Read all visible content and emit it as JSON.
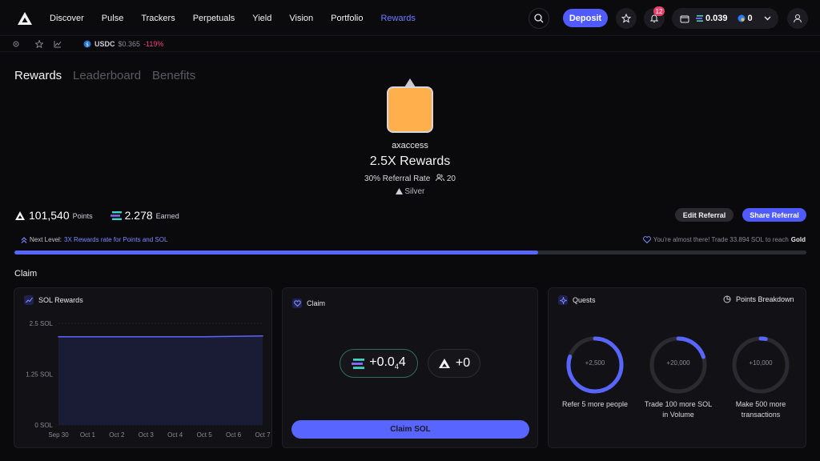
{
  "nav": {
    "links": [
      "Discover",
      "Pulse",
      "Trackers",
      "Perpetuals",
      "Yield",
      "Vision",
      "Portfolio",
      "Rewards"
    ],
    "active": "Rewards",
    "deposit_label": "Deposit",
    "notifications": "12",
    "wallet_sol": "0.039",
    "wallet_other": "0"
  },
  "subbar": {
    "ticker_symbol": "USDC",
    "ticker_price": "$0.365",
    "ticker_change": "-119%"
  },
  "tabs": [
    "Rewards",
    "Leaderboard",
    "Benefits"
  ],
  "profile": {
    "username": "axaccess",
    "multiplier": "2.5X Rewards",
    "referral_rate": "30% Referral Rate",
    "referral_count": "20",
    "tier": "Silver"
  },
  "points": {
    "points_value": "101,540",
    "points_label": "Points",
    "earned_value": "2.278",
    "earned_label": "Earned",
    "edit_referral": "Edit Referral",
    "share_referral": "Share Referral"
  },
  "progress": {
    "next_level_label": "Next Level:",
    "next_level_text": "3X Rewards rate for Points and SOL",
    "almost_text": "You're almost there! Trade 33.894 SOL to reach",
    "target_tier": "Gold",
    "fraction": 0.661
  },
  "claim_heading": "Claim",
  "sol_rewards": {
    "title": "SOL Rewards"
  },
  "claim_panel": {
    "title": "Claim",
    "sol_amount_main": "+0.0",
    "sol_amount_sub": "4",
    "sol_amount_end": "4",
    "points_amount": "+0",
    "button": "Claim SOL"
  },
  "quests": {
    "title": "Quests",
    "breakdown": "Points Breakdown",
    "items": [
      {
        "value": "+2,500",
        "desc1": "Refer 5 more people",
        "desc2": "",
        "progress": 0.8
      },
      {
        "value": "+20,000",
        "desc1": "Trade 100 more SOL",
        "desc2": "in Volume",
        "progress": 0.2
      },
      {
        "value": "+10,000",
        "desc1": "Make 500 more",
        "desc2": "transactions",
        "progress": 0.03
      }
    ]
  },
  "chart_data": {
    "type": "area",
    "title": "SOL Rewards",
    "x": [
      "Sep 30",
      "Oct 1",
      "Oct 2",
      "Oct 3",
      "Oct 4",
      "Oct 5",
      "Oct 6",
      "Oct 7"
    ],
    "series": [
      {
        "values": [
          2.17,
          2.17,
          2.17,
          2.17,
          2.17,
          2.17,
          2.18,
          2.19
        ]
      }
    ],
    "yticks": [
      "2.5 SOL",
      "1.25 SOL",
      "0 SOL"
    ],
    "ylim": [
      0,
      2.5
    ],
    "grid": true,
    "colors": {
      "line": "#5865ff",
      "fill": "#1a1c36"
    }
  },
  "colors": {
    "accent": "#4f5bff",
    "negative": "#ec4a7a",
    "avatar": "#ffb04d"
  }
}
